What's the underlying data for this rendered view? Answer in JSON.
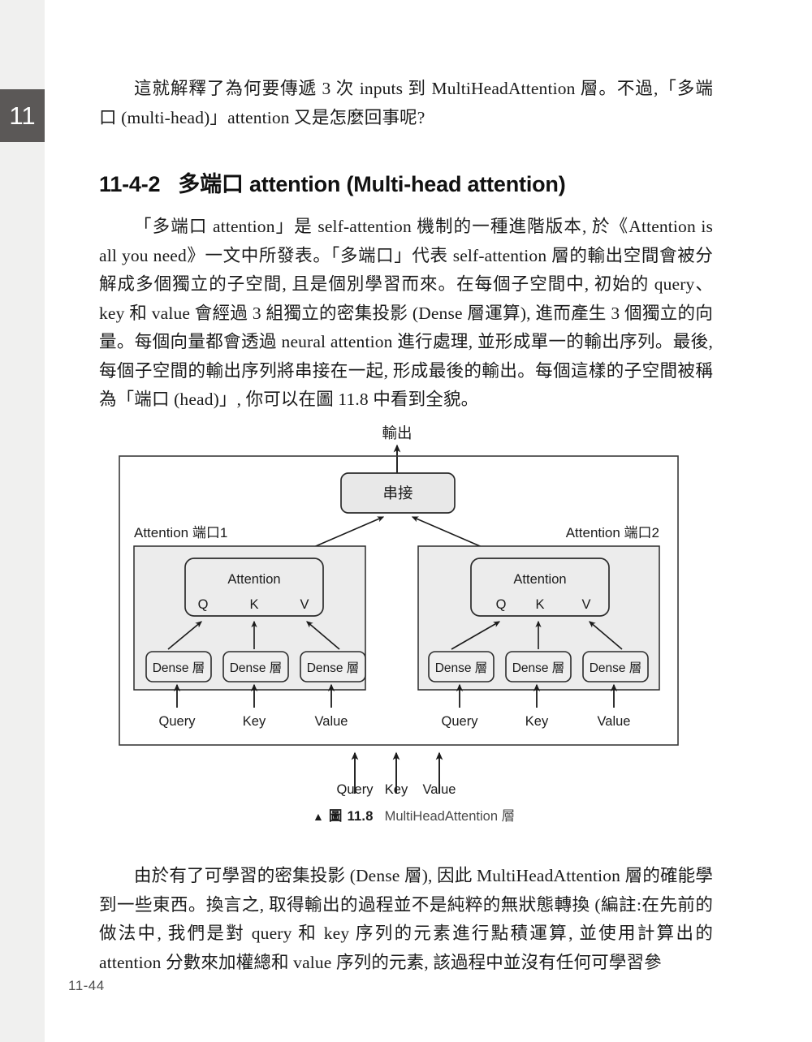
{
  "chapter_tab": {
    "number": "11"
  },
  "page_number": "11-44",
  "paragraphs": {
    "top": "這就解釋了為何要傳遞 3 次 inputs 到 MultiHeadAttention 層。不過,「多端口 (multi-head)」attention 又是怎麼回事呢?",
    "intro": "「多端口 attention」是 self-attention 機制的一種進階版本, 於《Attention is all you need》一文中所發表。「多端口」代表 self-attention 層的輸出空間會被分解成多個獨立的子空間, 且是個別學習而來。在每個子空間中, 初始的 query、 key 和 value 會經過 3 組獨立的密集投影 (Dense 層運算), 進而產生 3 個獨立的向量。每個向量都會透過 neural attention 進行處理, 並形成單一的輸出序列。最後, 每個子空間的輸出序列將串接在一起, 形成最後的輸出。每個這樣的子空間被稱為「端口 (head)」, 你可以在圖 11.8 中看到全貌。",
    "bottom": "由於有了可學習的密集投影 (Dense 層), 因此 MultiHeadAttention 層的確能學到一些東西。換言之, 取得輸出的過程並不是純粹的無狀態轉換 (編註:在先前的做法中, 我們是對 query 和 key 序列的元素進行點積運算, 並使用計算出的attention 分數來加權總和 value 序列的元素, 該過程中並沒有任何可學習參"
  },
  "heading": {
    "number": "11-4-2",
    "text": "多端口 attention (Multi-head attention)"
  },
  "figure": {
    "caption_marker": "▲",
    "caption_icon": "圖",
    "caption_number": "11.8",
    "caption_text": "MultiHeadAttention 層",
    "output_label": "輸出",
    "concat_label": "串接",
    "heads": [
      {
        "title": "Attention 端口1",
        "attention_label": "Attention",
        "ports": [
          "Q",
          "K",
          "V"
        ],
        "dense_labels": [
          "Dense 層",
          "Dense 層",
          "Dense 層"
        ],
        "input_labels": [
          "Query",
          "Key",
          "Value"
        ]
      },
      {
        "title": "Attention 端口2",
        "attention_label": "Attention",
        "ports": [
          "Q",
          "K",
          "V"
        ],
        "dense_labels": [
          "Dense 層",
          "Dense 層",
          "Dense 層"
        ],
        "input_labels": [
          "Query",
          "Key",
          "Value"
        ]
      }
    ],
    "bottom_inputs": [
      "Query",
      "Key",
      "Value"
    ],
    "colors": {
      "box_fill": "#e8e8e8",
      "head_fill": "#ececec",
      "stroke": "#2b2b2b",
      "frame_stroke": "#3a3a3a"
    }
  }
}
